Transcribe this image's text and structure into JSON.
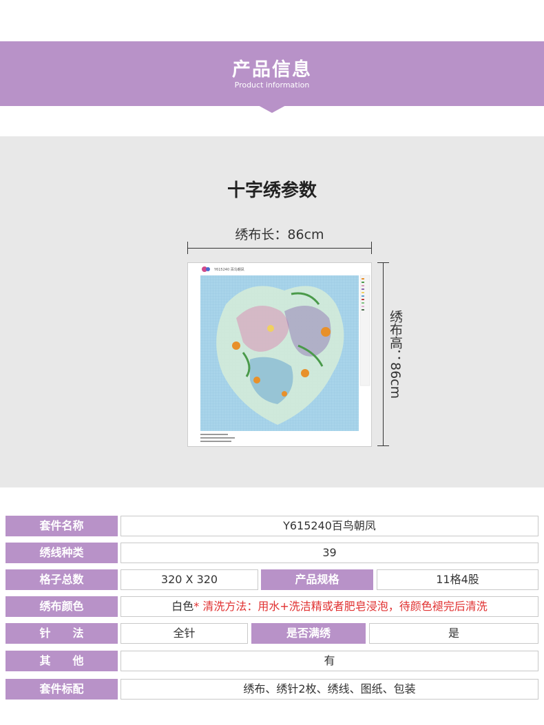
{
  "banner": {
    "title": "产品信息",
    "subtitle": "Product information"
  },
  "params": {
    "title": "十字绣参数",
    "length_label": "绣布长：86cm",
    "height_label": "绣布高：86cm"
  },
  "pattern": {
    "code_title": "Y615240 百鸟朝凤",
    "colors": {
      "background": "#a8d4ea",
      "accent_orange": "#e8902a",
      "accent_green": "#4a9a4a",
      "accent_pink": "#d89ab8"
    }
  },
  "table": {
    "kit_name_label": "套件名称",
    "kit_name_value": "Y615240百鸟朝凤",
    "thread_types_label": "绣线种类",
    "thread_types_value": "39",
    "grid_total_label": "格子总数",
    "grid_total_value": "320 X 320",
    "spec_label": "产品规格",
    "spec_value": "11格4股",
    "fabric_color_label": "绣布颜色",
    "fabric_color_value": "白色",
    "wash_note": "* 清洗方法：用水+洗洁精或者肥皂浸泡，待颜色褪完后清洗",
    "stitch_label": "针　　法",
    "stitch_value": "全针",
    "full_label": "是否满绣",
    "full_value": "是",
    "other_label": "其　　他",
    "other_value": "有",
    "kit_contents_label": "套件标配",
    "kit_contents_value": "绣布、绣针2枚、绣线、图纸、包装"
  }
}
